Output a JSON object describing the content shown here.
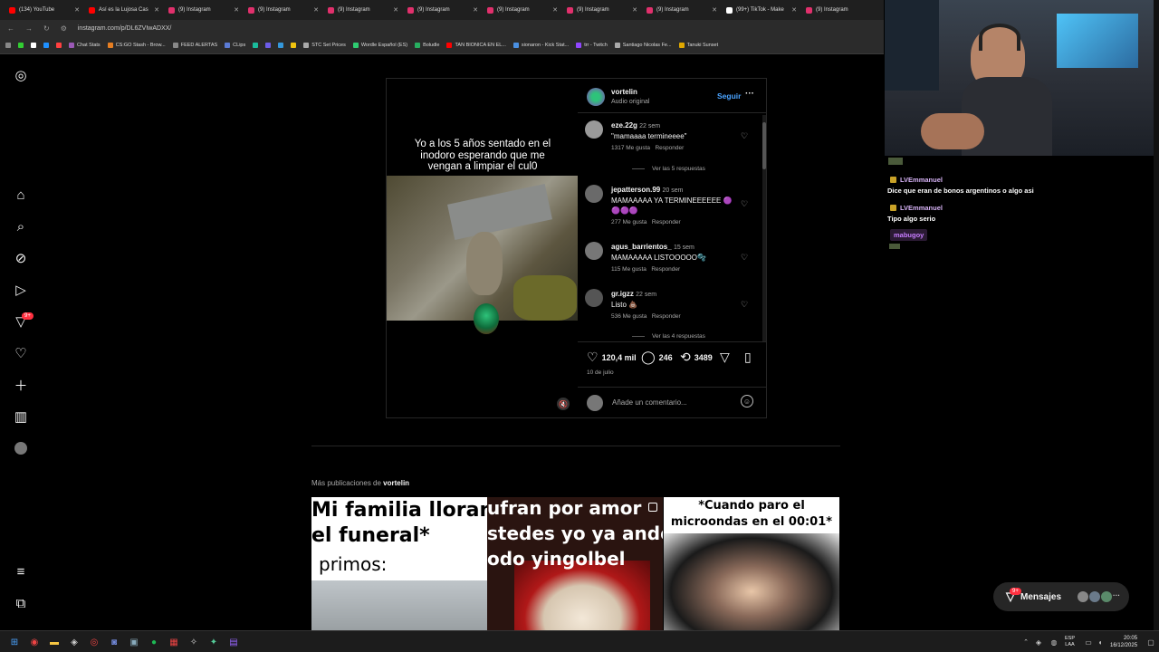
{
  "browser": {
    "tabs": [
      {
        "label": "(134) YouTube",
        "color": "#ff0000"
      },
      {
        "label": "Así es la Lujosa Cas",
        "color": "#ff0000"
      },
      {
        "label": "(9) Instagram",
        "color": "#e1306c"
      },
      {
        "label": "(9) Instagram",
        "color": "#e1306c"
      },
      {
        "label": "(9) Instagram",
        "color": "#e1306c"
      },
      {
        "label": "(9) Instagram",
        "color": "#e1306c"
      },
      {
        "label": "(9) Instagram",
        "color": "#e1306c"
      },
      {
        "label": "(9) Instagram",
        "color": "#e1306c"
      },
      {
        "label": "(9) Instagram",
        "color": "#e1306c"
      },
      {
        "label": "(99+) TikTok - Make",
        "color": "#ffffff"
      },
      {
        "label": "(9) Instagram",
        "color": "#e1306c"
      }
    ],
    "url": "instagram.com/p/DL6ZVIwADXX/",
    "bookmarks": [
      "Chat Stats",
      "CS:GO Stash - Brow...",
      "FEED ALERTAS",
      "CLips",
      "STC Set Prices",
      "Wordle Español (ES)",
      "Boludle",
      "TAN BIONICA EN EL...",
      "sionaron - Kick Stat...",
      "trr - Twitch",
      "Santiago Nicolas Fe...",
      "Tanuki Sunset"
    ]
  },
  "post": {
    "caption_video": "Yo a los 5 años sentado en el inodoro esperando que me vengan a limpiar el cul0",
    "author": "vortelin",
    "audio": "Audio original",
    "follow": "Seguir",
    "more": "···",
    "comments": [
      {
        "user": "eze.22g",
        "time": "22 sem",
        "text": "\"mamaaaa termineeee\"",
        "likes": "1317 Me gusta",
        "reply": "Responder",
        "view_replies": "Ver las 5 respuestas"
      },
      {
        "user": "jepatterson.99",
        "time": "20 sem",
        "text": "MAMAAAAA YA TERMINEEEEEE 🟣🟣🟣🟣",
        "likes": "277 Me gusta",
        "reply": "Responder"
      },
      {
        "user": "agus_barrientos_",
        "time": "15 sem",
        "text": "MAMAAAAA LISTOOOOO🫧",
        "likes": "115 Me gusta",
        "reply": "Responder"
      },
      {
        "user": "gr.igzz",
        "time": "22 sem",
        "text": "Listo 💩",
        "likes": "536 Me gusta",
        "reply": "Responder",
        "view_replies": "Ver las 4 respuestas"
      }
    ],
    "likes": "120,4 mil",
    "comment_count": "246",
    "reposts": "3489",
    "date": "10 de julio",
    "add_comment_placeholder": "Añade un comentario..."
  },
  "more_posts": {
    "label_prefix": "Más publicaciones de",
    "label_user": "vortelin",
    "thumbs": [
      {
        "line1": "Mi familia llorand",
        "line2": "el funeral*",
        "line3": "primos:"
      },
      {
        "line1": "ufran por amor",
        "line2": "stedes yo ya ando c",
        "line3": "odo yingolbel"
      },
      {
        "line1": "*Cuando paro el",
        "line2": "microondas en el 00:01*"
      }
    ]
  },
  "chat": {
    "messages": [
      {
        "user": "LVEmmanuel",
        "text": "Dice que eran de bonos argentinos o algo asi"
      },
      {
        "user": "LVEmmanuel",
        "text": "Tipo algo serio"
      }
    ],
    "next_user": "mabugoy"
  },
  "messages_pill": {
    "label": "Mensajes",
    "badge": "9+"
  },
  "nav": {
    "notif_badge": "9+"
  },
  "taskbar": {
    "lang1": "ESP",
    "lang2": "LAA",
    "time": "20:05",
    "date": "16/12/2025"
  }
}
